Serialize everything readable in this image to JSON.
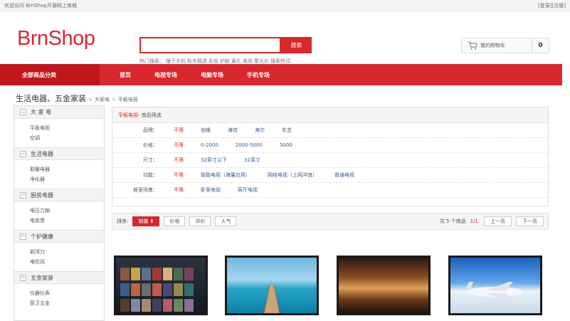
{
  "topbar": {
    "welcome": "欢迎访问 BrnShop开源网上商城",
    "login": "[登录]",
    "register": "[注册]"
  },
  "header": {
    "logo": "BrnShop",
    "search_placeholder": "",
    "search_button": "搜索",
    "hot_label": "热门搜索：",
    "hot_words": [
      "锤子手机",
      "秋冬精选",
      "彩妆",
      "护肤",
      "豪礼",
      "电视",
      "聚光价",
      "搜索热词"
    ],
    "cart_label": "我的购物车",
    "cart_count": "0"
  },
  "nav": {
    "all": "全部商品分类",
    "items": [
      "首页",
      "电视专场",
      "电脑专场",
      "手机专场"
    ]
  },
  "breadcrumb": {
    "root": "生活电器、五金家装",
    "level1": "大家电",
    "level2": "平板电视"
  },
  "sidebar": [
    {
      "title": "大 家 电",
      "links": [
        "平板电视",
        "空调"
      ]
    },
    {
      "title": "生活电器",
      "links": [
        "取暖电器",
        "净化器"
      ]
    },
    {
      "title": "厨房电器",
      "links": [
        "电压力锅",
        "电饭煲"
      ]
    },
    {
      "title": "个护健康",
      "links": [
        "剃须刀",
        "电吹风"
      ]
    },
    {
      "title": "五金家装",
      "links": [
        "仪器仪表",
        "厨卫五金"
      ]
    }
  ],
  "filter": {
    "current": "平板电视",
    "suffix": " - 商品筛选",
    "rows": [
      {
        "label": "品牌：",
        "options": [
          "不限",
          "创维",
          "海信",
          "海尔",
          "东芝"
        ]
      },
      {
        "label": "价格：",
        "options": [
          "不限",
          "0-2000",
          "2000-5000",
          "5000"
        ]
      },
      {
        "label": "尺寸：",
        "options": [
          "不限",
          "32英寸以下",
          "32英寸"
        ]
      },
      {
        "label": "功能：",
        "options": [
          "不限",
          "智能电视（海量应用）",
          "网络电视（上网冲浪）",
          "普通电视"
        ]
      },
      {
        "label": "居室场景：",
        "options": [
          "不限",
          "卧室电视",
          "客厅电视"
        ]
      }
    ]
  },
  "sortbar": {
    "label": "排序:",
    "buttons": [
      "销量 ⬆",
      "价格",
      "评价",
      "人气"
    ],
    "count": "共 5 个商品",
    "page": "1/1",
    "prev": "上一页",
    "next": "下一页"
  },
  "colors": {
    "accent": "#d9272e",
    "accent_dark": "#c2151c",
    "link": "#3a5b8c"
  }
}
